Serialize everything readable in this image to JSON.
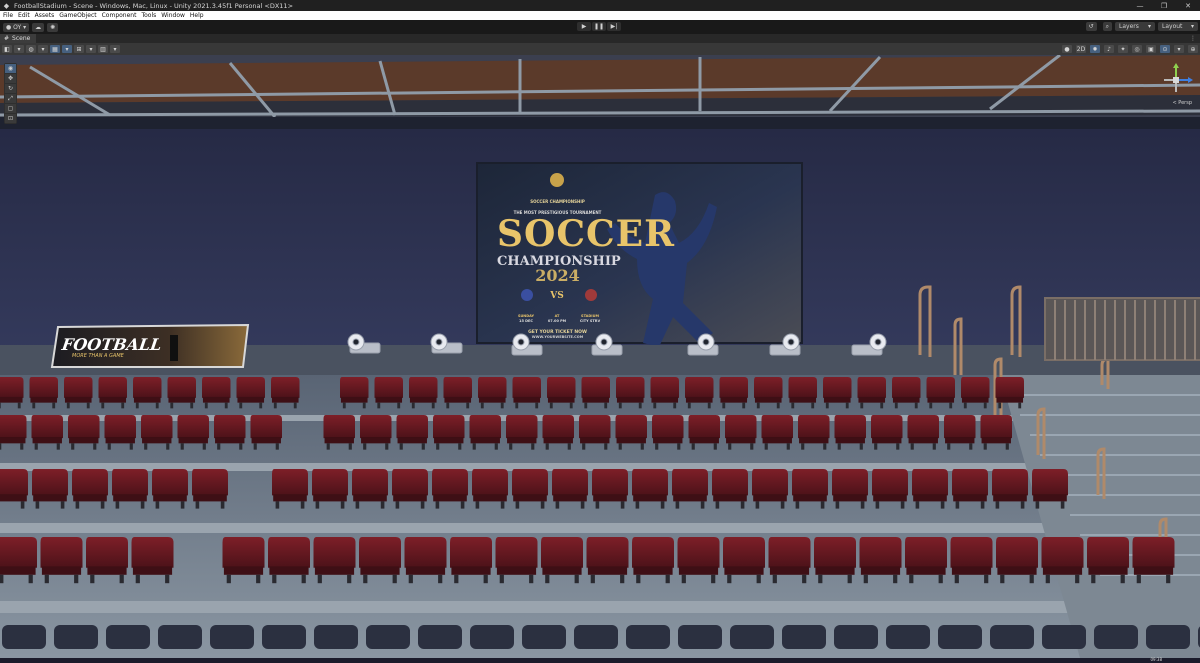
{
  "window": {
    "title": "FootballStadium - Scene - Windows, Mac, Linux - Unity 2021.3.45f1 Personal <DX11>",
    "controls": [
      "—",
      "❐",
      "✕"
    ]
  },
  "menu": [
    "File",
    "Edit",
    "Assets",
    "GameObject",
    "Component",
    "Tools",
    "Window",
    "Help"
  ],
  "toolbar": {
    "account": "OY",
    "layers_label": "Layers",
    "layout_label": "Layout"
  },
  "scene_tab": {
    "label": "Scene"
  },
  "view": {
    "persp_label": "< Persp"
  },
  "poster": {
    "brand": "SOCCER CHAMPIONSHIP",
    "tagline": "THE MOST PRESTIGIOUS TOURNAMENT",
    "title": "SOCCER",
    "subtitle": "CHAMPIONSHIP",
    "year": "2024",
    "versus": "VS",
    "date_label": "SUNDAY",
    "date_value": "15 DEC",
    "time_label": "AT",
    "time_value": "07.00 PM",
    "venue_label": "STADIUM",
    "venue_value": "CITY STRV",
    "cta": "GET YOUR TICKET NOW",
    "website": "WWW.YOURWEBSITE.COM"
  },
  "banner": {
    "title": "FOOTBALL",
    "tagline": "MORE THAN A GAME"
  },
  "taskbar": {
    "clock": "09:38"
  },
  "colors": {
    "seat": "#6e1a22",
    "wall": "#2c3050",
    "stands": "#6e7a86",
    "accent_gold": "#e8c46a"
  }
}
